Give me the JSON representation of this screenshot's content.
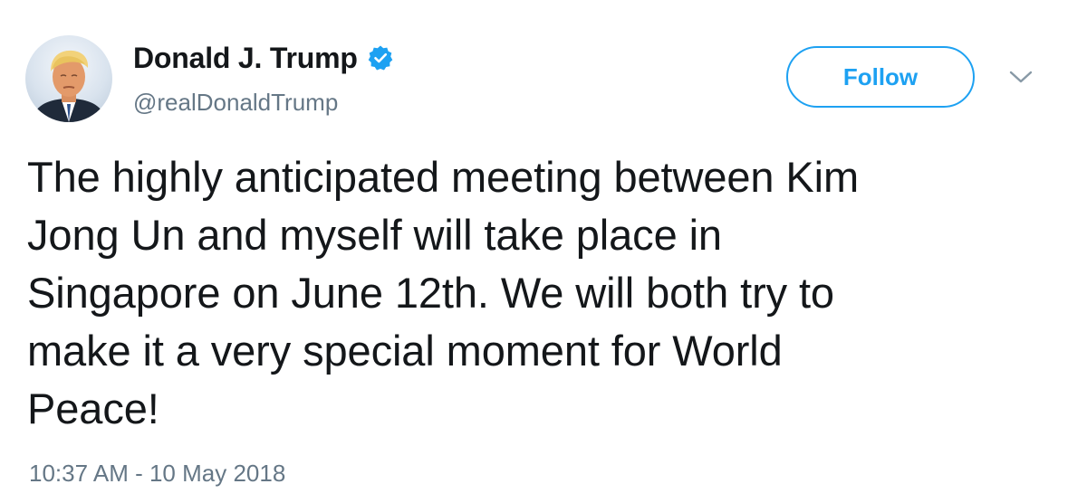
{
  "tweet": {
    "display_name": "Donald J. Trump",
    "handle": "@realDonaldTrump",
    "verified": true,
    "follow_label": "Follow",
    "text_lines": [
      "The highly anticipated meeting between Kim",
      "Jong Un and myself will take place in",
      "Singapore on June 12th. We will both try to",
      "make it a very special moment for World",
      "Peace!"
    ],
    "timestamp": "10:37 AM - 10 May 2018"
  },
  "icons": {
    "verified": "verified-badge-icon",
    "menu": "chevron-down-icon"
  },
  "colors": {
    "accent": "#1da1f2",
    "text_primary": "#14171a",
    "text_secondary": "#657786",
    "background": "#ffffff"
  }
}
